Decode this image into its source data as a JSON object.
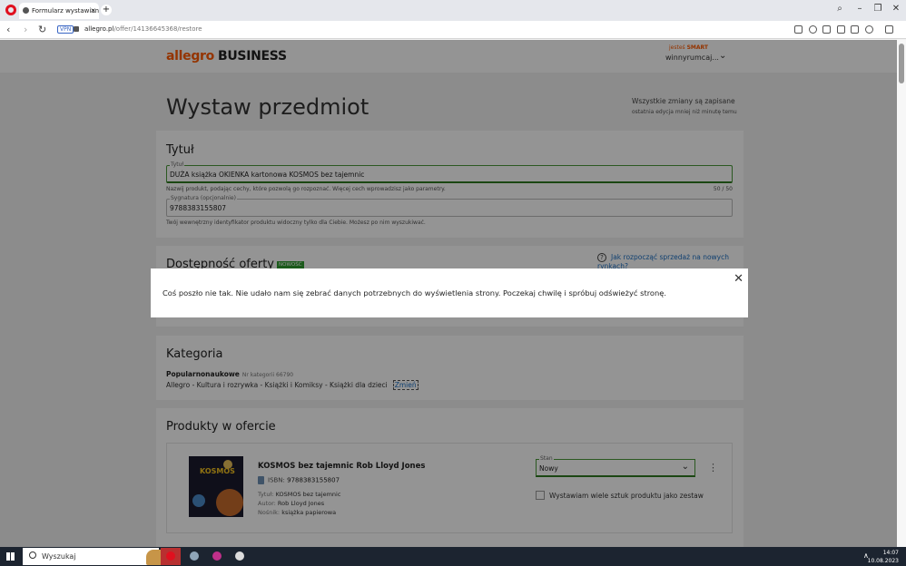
{
  "browser": {
    "tab_title": "Formularz wystawiania",
    "url_host": "allegro.pl",
    "url_path": "/offer/14136645368/restore",
    "vpn_label": "VPN"
  },
  "header": {
    "logo": "allegro",
    "logo_business": "BUSINESS",
    "smart_prefix": "jesteś",
    "smart_label": "SMART",
    "user": "winnyrumcaj..."
  },
  "page": {
    "title": "Wystaw przedmiot",
    "saved_status": "Wszystkie zmiany są zapisane",
    "saved_sub": "ostatnia edycja mniej niż minutę temu"
  },
  "title_section": {
    "heading": "Tytuł",
    "title_label": "Tytuł",
    "title_value": "DUŻA książka OKIENKA kartonowa KOSMOS bez tajemnic",
    "title_hint": "Nazwij produkt, podając cechy, które pozwolą go rozpoznać. Więcej cech wprowadzisz jako parametry.",
    "title_counter": "50 / 50",
    "signature_label": "Sygnatura (opcjonalnie)",
    "signature_value": "9788383155807",
    "signature_hint": "Twój wewnętrzny identyfikator produktu widoczny tylko dla Ciebie. Możesz po nim wyszukiwać."
  },
  "availability_section": {
    "heading": "Dostępność oferty",
    "new_badge": "NOWOŚĆ",
    "help_link": "Jak rozpocząć sprzedaż na nowych rynkach?"
  },
  "category_section": {
    "heading": "Kategoria",
    "category_name": "Popularnonaukowe",
    "category_id": "Nr kategorii 66790",
    "category_path": "Allegro - Kultura i rozrywka - Książki i Komiksy - Książki dla dzieci",
    "change_link": "Zmień"
  },
  "products_section": {
    "heading": "Produkty w ofercie",
    "cover_text": "KOSMOS",
    "product_title": "KOSMOS bez tajemnic Rob Lloyd Jones",
    "isbn_label": "ISBN:",
    "isbn_value": "9788383155807",
    "attr_title_label": "Tytuł:",
    "attr_title_value": "KOSMOS bez tajemnic",
    "attr_author_label": "Autor:",
    "attr_author_value": "Rob Lloyd Jones",
    "attr_medium_label": "Nośnik:",
    "attr_medium_value": "książka papierowa",
    "condition_label": "Stan",
    "condition_value": "Nowy",
    "set_checkbox_label": "Wystawiam wiele sztuk produktu jako zestaw"
  },
  "modal": {
    "message": "Coś poszło nie tak. Nie udało nam się zebrać danych potrzebnych do wyświetlenia strony. Poczekaj chwilę i spróbuj odświeżyć stronę."
  },
  "taskbar": {
    "search_placeholder": "Wyszukaj",
    "time": "14:07",
    "date": "10.08.2023"
  },
  "colors": {
    "brand_orange": "#ff5a00",
    "accent_green": "#2f7a21",
    "link_blue": "#1b6ec2"
  }
}
